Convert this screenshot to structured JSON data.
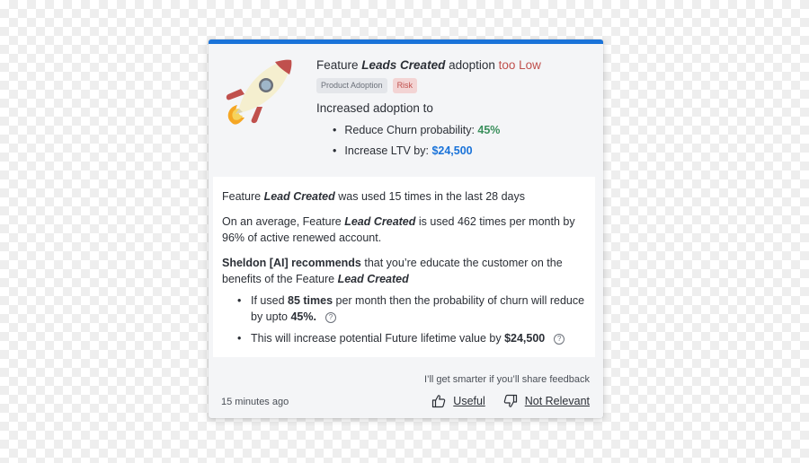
{
  "insight": {
    "title_prefix": "Feature ",
    "feature_name": "Leads Created",
    "title_middle": " adoption ",
    "title_status": "too Low",
    "tags": [
      {
        "label": "Product Adoption"
      },
      {
        "label": "Risk"
      }
    ],
    "subtitle": "Increased adoption to",
    "benefits": [
      {
        "label": "Reduce Churn probability: ",
        "value": "45%"
      },
      {
        "label": "Increase LTV by: ",
        "value": "$24,500"
      }
    ],
    "colors": {
      "accent": "#1a73d9",
      "risk": "#c0504d",
      "positive": "#3a8f5c"
    }
  },
  "details": {
    "usage": {
      "prefix": "Feature ",
      "feature": "Lead Created",
      "suffix": " was used 15 times in the last 28 days"
    },
    "average": {
      "prefix": "On an average, Feature ",
      "feature": "Lead Created",
      "suffix": " is used 462 times per month by 96% of active renewed account."
    },
    "recommendation": {
      "agent": "Sheldon [AI] recommends",
      "text": " that you’re educate the customer on the benefits of the Feature ",
      "feature": "Lead Created"
    },
    "points": [
      {
        "prefix": "If used ",
        "bold1": "85 times",
        "middle": " per month then the probability of churn will reduce by upto ",
        "bold2": "45%."
      },
      {
        "prefix": "This will increase potential Future lifetime value by ",
        "bold": "$24,500"
      }
    ],
    "help_glyph": "?"
  },
  "footer": {
    "feedback_hint": "I’ll get smarter if you’ll share feedback",
    "timestamp": "15 minutes ago",
    "useful_label": "Useful",
    "not_relevant_label": "Not Relevant"
  }
}
